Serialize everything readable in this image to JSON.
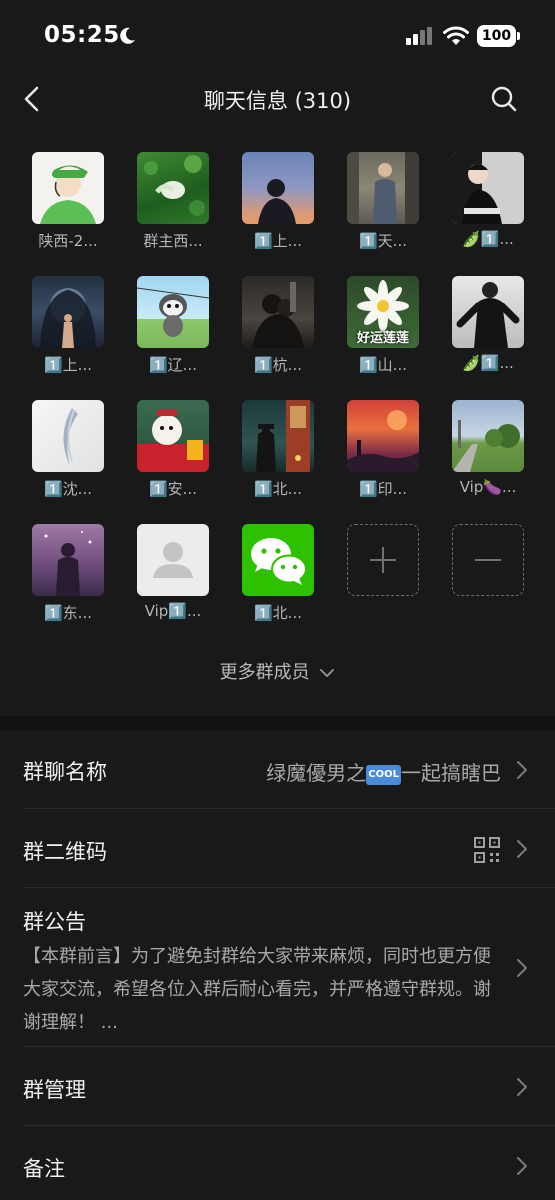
{
  "status": {
    "time": "05:25",
    "battery": "100"
  },
  "nav": {
    "title": "聊天信息 (310)"
  },
  "members": [
    {
      "name": "陕西-2..."
    },
    {
      "name": "群主西..."
    },
    {
      "name": "1️⃣上..."
    },
    {
      "name": "1️⃣天..."
    },
    {
      "name": "🫛1️⃣..."
    },
    {
      "name": "1️⃣上..."
    },
    {
      "name": "1️⃣辽..."
    },
    {
      "name": "1️⃣杭..."
    },
    {
      "name": "1️⃣山...",
      "overlay": "好运莲莲"
    },
    {
      "name": "🫛1️⃣..."
    },
    {
      "name": "1️⃣沈..."
    },
    {
      "name": "1️⃣安..."
    },
    {
      "name": "1️⃣北..."
    },
    {
      "name": "1️⃣印..."
    },
    {
      "name": "Vip🍆..."
    },
    {
      "name": "1️⃣东..."
    },
    {
      "name": "Vip1️⃣..."
    },
    {
      "name": "1️⃣北..."
    }
  ],
  "more_members": "更多群成员",
  "settings": {
    "group_name": {
      "label": "群聊名称",
      "value_prefix": "绿魔優男之",
      "badge": "COOL",
      "value_suffix": "一起搞瞎巴"
    },
    "qr_code": {
      "label": "群二维码"
    },
    "notice": {
      "label": "群公告",
      "text": "【本群前言】为了避免封群给大家带来麻烦，同时也更方便大家交流，希望各位入群后耐心看完，并严格遵守群规。谢谢理解！ ..."
    },
    "manage": {
      "label": "群管理"
    },
    "remark": {
      "label": "备注"
    }
  },
  "colors": {
    "background": "#191919",
    "wechat_green": "#2dc100"
  }
}
